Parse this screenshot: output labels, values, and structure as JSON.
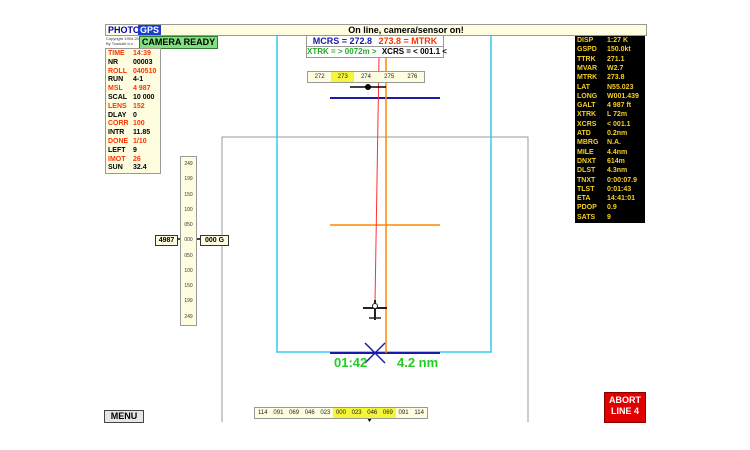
{
  "tabs": {
    "photo": "PHOTO",
    "gps": "GPS"
  },
  "status": "On line, camera/sensor on!",
  "copyright": [
    "Copyright 1994-2008",
    "By TrackAir b.v."
  ],
  "camera_status": "CAMERA READY",
  "colors": {
    "orange_value": "#ff3300",
    "yellow_label": "#f5d020",
    "green": "#22cc22",
    "blue_line": "#1a1aa8",
    "cyan_frame": "#35c8ee"
  },
  "left_panel": [
    {
      "k": "TIME",
      "v": "14:39",
      "color": "#ff3300"
    },
    {
      "k": "NR",
      "v": "00003",
      "color": "#000000"
    },
    {
      "k": "ROLL",
      "v": "040510",
      "color": "#ff3300"
    },
    {
      "k": "RUN",
      "v": "4-1",
      "color": "#000000"
    },
    {
      "k": "MSL",
      "v": "4 987",
      "color": "#ff3300"
    },
    {
      "k": "SCAL",
      "v": "10 000",
      "color": "#000000"
    },
    {
      "k": "LENS",
      "v": "152",
      "color": "#ff3300"
    },
    {
      "k": "DLAY",
      "v": "0",
      "color": "#000000"
    },
    {
      "k": "CORR",
      "v": "100",
      "color": "#ff3300"
    },
    {
      "k": "INTR",
      "v": "11.85",
      "color": "#000000"
    },
    {
      "k": "DONE",
      "v": "1/10",
      "color": "#ff3300"
    },
    {
      "k": "LEFT",
      "v": "9",
      "color": "#000000"
    },
    {
      "k": "IMOT",
      "v": "26",
      "color": "#ff3300"
    },
    {
      "k": "SUN",
      "v": "32.4",
      "color": "#000000"
    }
  ],
  "right_panel": [
    {
      "k": "DISP",
      "v": "1:27 K"
    },
    {
      "k": "GSPD",
      "v": "150.0kt"
    },
    {
      "k": "TTRK",
      "v": "271.1"
    },
    {
      "k": "MVAR",
      "v": "W2.7"
    },
    {
      "k": "MTRK",
      "v": "273.8"
    },
    {
      "k": "LAT",
      "v": "N55.023"
    },
    {
      "k": "LONG",
      "v": "W001.439"
    },
    {
      "k": "GALT",
      "v": "4 987 ft"
    },
    {
      "k": "XTRK",
      "v": "L 72m"
    },
    {
      "k": "XCRS",
      "v": "< 001.1"
    },
    {
      "k": "ATD",
      "v": "0.2nm"
    },
    {
      "k": "MBRG",
      "v": "N.A."
    },
    {
      "k": "MILE",
      "v": "4.4nm"
    },
    {
      "k": "DNXT",
      "v": "614m"
    },
    {
      "k": "DLST",
      "v": "4.3nm"
    },
    {
      "k": "TNXT",
      "v": "0:00:07.9"
    },
    {
      "k": "TLST",
      "v": "0:01:43"
    },
    {
      "k": "ETA",
      "v": "14:41:01"
    },
    {
      "k": "PDOP",
      "v": "0.9"
    },
    {
      "k": "SATS",
      "v": "9"
    }
  ],
  "nav": {
    "mcrs": "MCRS = 272.8",
    "mtrk": "273.8 = MTRK",
    "xtrk": "XTRK = > 0072m >",
    "xcrs": "XCRS = < 001.1 <"
  },
  "course_tape": [
    "272",
    "273",
    "274",
    "275",
    "276"
  ],
  "bottom_tape": [
    "114",
    "091",
    "069",
    "046",
    "023",
    "000",
    "023",
    "046",
    "069",
    "091",
    "114"
  ],
  "alt_scale": [
    "249",
    "199",
    "150",
    "100",
    "050",
    "000",
    "050",
    "100",
    "150",
    "199",
    "249"
  ],
  "altitude": "4987",
  "g_value": "000 G",
  "eta_time": "01:42",
  "dist_remaining": "4.2 nm",
  "menu_label": "MENU",
  "abort_label": [
    "ABORT",
    "LINE 4"
  ]
}
